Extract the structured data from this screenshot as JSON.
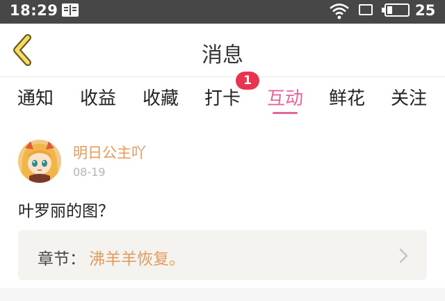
{
  "status_bar": {
    "time": "18:29",
    "battery_level": "25",
    "battery_fraction": 0.25
  },
  "header": {
    "title": "消息"
  },
  "tabs": [
    {
      "label": "通知"
    },
    {
      "label": "收益"
    },
    {
      "label": "收藏"
    },
    {
      "label": "打卡",
      "badge": "1"
    },
    {
      "label": "互动",
      "active": true
    },
    {
      "label": "鲜花"
    },
    {
      "label": "关注"
    }
  ],
  "message": {
    "username": "明日公主吖",
    "date": "08-19",
    "text": "叶罗丽的图？",
    "chapter_label": "章节：",
    "chapter_name": "沸羊羊恢复。"
  },
  "colors": {
    "accent": "#e8639a",
    "username": "#e59a5a",
    "badge": "#e8344e",
    "status_bar": "#474747"
  },
  "icons": [
    "book-icon",
    "wifi-icon",
    "sim-icon",
    "battery-icon",
    "back-chevron-icon",
    "chevron-right-icon"
  ]
}
